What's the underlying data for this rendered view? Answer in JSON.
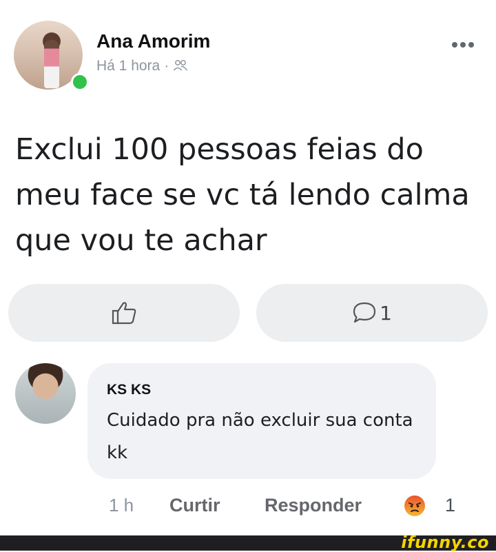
{
  "post": {
    "author": "Ana Amorim",
    "time": "Há 1 hora",
    "separator": "·",
    "privacy_icon": "friends-icon",
    "text": "Exclui 100 pessoas feias do meu face se vc tá lendo calma que vou te achar"
  },
  "actions": {
    "like_icon": "thumbs-up-icon",
    "comment_icon": "comment-icon",
    "comment_count": "1"
  },
  "comment": {
    "author": "KS KS",
    "text": "Cuidado pra não excluir sua conta kk",
    "time": "1 h",
    "like_label": "Curtir",
    "reply_label": "Responder",
    "reaction_icon": "angry-reaction-icon",
    "reaction_count": "1"
  },
  "watermark": {
    "text": "ifunny.co"
  },
  "colors": {
    "online": "#31c24d",
    "button_bg": "#eceef0",
    "bubble_bg": "#f0f2f5",
    "meta_text": "#8d949e",
    "watermark": "#f5d400"
  }
}
